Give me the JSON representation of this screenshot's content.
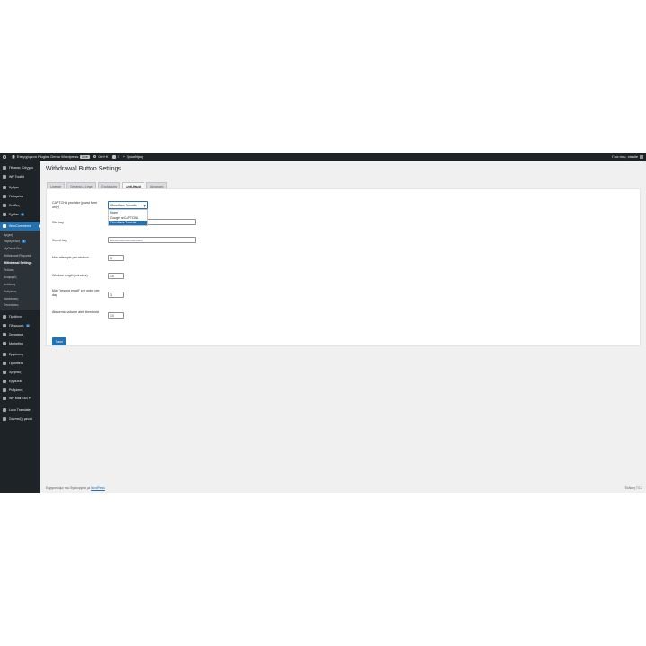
{
  "admin_bar": {
    "site_name": "Επερχόμενο Plugins Demo Wordpress",
    "live_badge": "Live",
    "shortcut": "Ctrl+K",
    "comments_count": "2",
    "new_label": "Προσθήκη",
    "greeting": "Γεια σου, xtasile"
  },
  "sidebar": {
    "top_items": [
      {
        "label": "Πίνακας Ελέγχου",
        "icon": "dashboard-icon"
      },
      {
        "label": "WP Toolkit",
        "icon": "toolkit-icon"
      }
    ],
    "content_items": [
      {
        "label": "Άρθρα",
        "icon": "pin-icon"
      },
      {
        "label": "Πολυμέσα",
        "icon": "media-icon"
      },
      {
        "label": "Σελίδες",
        "icon": "page-icon"
      },
      {
        "label": "Σχόλια",
        "icon": "comment-icon",
        "badge": "2"
      }
    ],
    "woocommerce": {
      "label": "WooCommerce",
      "icon": "woo-icon"
    },
    "woo_submenu": [
      {
        "label": "Αρχική",
        "current": false
      },
      {
        "label": "Παραγγελίες",
        "current": false,
        "badge": "1"
      },
      {
        "label": "MyGreek Pro",
        "current": false
      },
      {
        "label": "Withdrawal Requests",
        "current": false
      },
      {
        "label": "Withdrawal Settings",
        "current": true
      },
      {
        "label": "Πελάτες",
        "current": false
      },
      {
        "label": "Αναφορές",
        "current": false
      },
      {
        "label": "Ανάλυση",
        "current": false
      },
      {
        "label": "Ρυθμίσεις",
        "current": false
      },
      {
        "label": "Κατάσταση",
        "current": false
      },
      {
        "label": "Επεκτάσεις",
        "current": false
      }
    ],
    "lower_items": [
      {
        "label": "Προϊόντα",
        "icon": "products-icon"
      },
      {
        "label": "Πληρωμές",
        "icon": "payments-icon",
        "badge": "1"
      },
      {
        "label": "Στατιστικά",
        "icon": "stats-icon"
      },
      {
        "label": "Marketing",
        "icon": "megaphone-icon"
      }
    ],
    "admin_items": [
      {
        "label": "Εμφάνιση",
        "icon": "brush-icon"
      },
      {
        "label": "Πρόσθετα",
        "icon": "plugin-icon"
      },
      {
        "label": "Χρήστες",
        "icon": "users-icon"
      },
      {
        "label": "Εργαλεία",
        "icon": "wrench-icon"
      },
      {
        "label": "Ρυθμίσεις",
        "icon": "settings-icon"
      },
      {
        "label": "WP Mail SMTP",
        "icon": "mail-icon"
      }
    ],
    "extra_items": [
      {
        "label": "Loco Translate",
        "icon": "translate-icon"
      },
      {
        "label": "Σύμπτυξη μενού",
        "icon": "collapse-icon"
      }
    ]
  },
  "page": {
    "title": "Withdrawal Button Settings",
    "tabs": [
      {
        "label": "License",
        "active": false
      },
      {
        "label": "General & Legal",
        "active": false
      },
      {
        "label": "Exclusions",
        "active": false
      },
      {
        "label": "Anti-fraud",
        "active": true
      },
      {
        "label": "Advanced",
        "active": false
      }
    ],
    "captcha": {
      "label": "CAPTCHA provider (guest form only)",
      "selected": "Cloudflare Turnstile",
      "options": [
        "None",
        "Google reCAPTCHA",
        "Cloudflare Turnstile"
      ]
    },
    "site_key": {
      "label": "Site key",
      "value": ""
    },
    "secret_key": {
      "label": "Secret key",
      "value": "••••••••••••••••••••••••••••••"
    },
    "max_attempts": {
      "label": "Max attempts per window",
      "value": "5"
    },
    "window_length": {
      "label": "Window length (minutes)",
      "value": "15"
    },
    "max_resend": {
      "label": "Max \"resend email\" per order per day",
      "value": "3"
    },
    "abnormal": {
      "label": "Abnormal-volume alert threshold",
      "value": "10"
    },
    "save_label": "Save"
  },
  "footer": {
    "thanks": "Ευχαριστούμε που δημιουργείτε με ",
    "link": "WordPress",
    "version": "Έκδοση 7.0.2"
  }
}
